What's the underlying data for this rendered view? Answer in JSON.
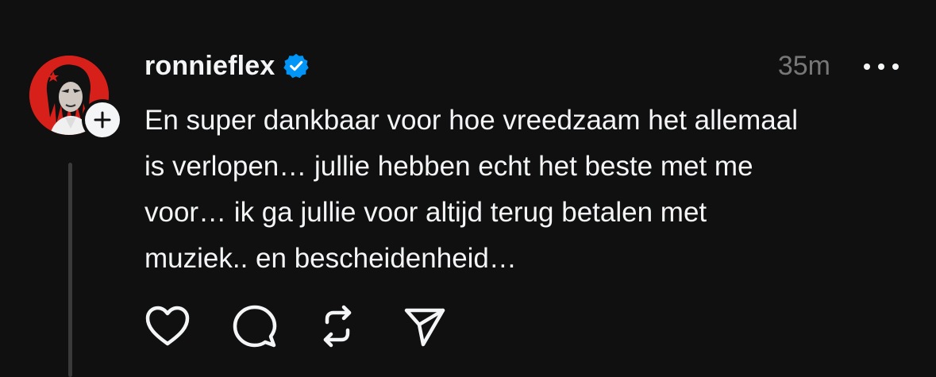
{
  "post": {
    "username": "ronnieflex",
    "verified": true,
    "timestamp": "35m",
    "body_lines": [
      "En super dankbaar voor hoe vreedzaam het allemaal",
      "is verlopen… jullie hebben echt het beste met me",
      "voor… ik ga jullie voor altijd terug betalen met",
      "muziek.. en bescheidenheid…"
    ]
  },
  "icons": {
    "avatar": "avatar-image",
    "follow": "plus-icon",
    "verified": "verified-badge-icon",
    "more": "more-options-icon",
    "like": "heart-icon",
    "reply": "comment-icon",
    "repost": "repost-icon",
    "share": "send-icon"
  },
  "colors": {
    "background": "#101010",
    "text": "#f3f5f7",
    "muted": "#777777",
    "verified_blue": "#0095f6",
    "avatar_red": "#d8201b"
  }
}
